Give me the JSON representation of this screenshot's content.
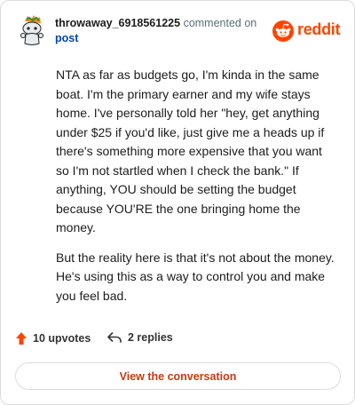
{
  "header": {
    "username": "throwaway_6918561225",
    "action_text": "commented on",
    "post_link": "post",
    "brand_name": "reddit"
  },
  "comment": {
    "paragraphs": [
      "NTA as far as budgets go, I'm kinda in the same boat. I'm the primary earner and my wife stays home. I've personally told her \"hey, get anything under $25 if you'd like, just give me a heads up if there's something more expensive that you want so I'm not startled when I check the bank.\" If anything, YOU should be setting the budget because YOU'RE the one bringing home the money.",
      "But the reality here is that it's not about the money. He's using this as a way to control you and make you feel bad."
    ]
  },
  "footer": {
    "upvotes": "10 upvotes",
    "replies": "2 replies",
    "view_conversation": "View the conversation"
  },
  "colors": {
    "brand": "#ff4500",
    "link": "#0045ac",
    "cta": "#c73a0f"
  },
  "icons": {
    "avatar": "snoo-avatar-icon",
    "brand": "reddit-logo-icon",
    "upvote": "upvote-arrow-icon",
    "reply": "reply-arrow-icon"
  }
}
